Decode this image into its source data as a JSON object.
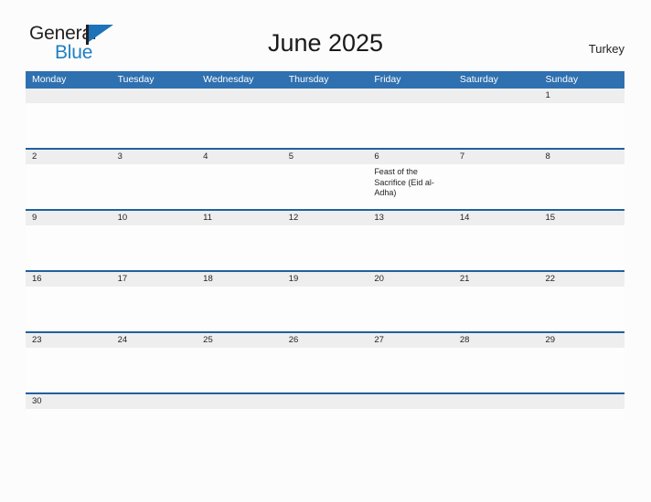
{
  "brand": {
    "name_part1": "General",
    "name_part2": "Blue",
    "flag_icon": "blue-triangle-flag-icon"
  },
  "header": {
    "title": "June 2025",
    "country": "Turkey"
  },
  "colors": {
    "header_blue": "#2f70b0",
    "rule_blue": "#20619e",
    "strip_gray": "#eeeeee",
    "brand_blue": "#1e7fc2",
    "page_background": "#fcfcfc"
  },
  "calendar": {
    "weekdays": [
      "Monday",
      "Tuesday",
      "Wednesday",
      "Thursday",
      "Friday",
      "Saturday",
      "Sunday"
    ],
    "weeks": [
      {
        "days": [
          {
            "number": "",
            "events": []
          },
          {
            "number": "",
            "events": []
          },
          {
            "number": "",
            "events": []
          },
          {
            "number": "",
            "events": []
          },
          {
            "number": "",
            "events": []
          },
          {
            "number": "",
            "events": []
          },
          {
            "number": "1",
            "events": []
          }
        ]
      },
      {
        "days": [
          {
            "number": "2",
            "events": []
          },
          {
            "number": "3",
            "events": []
          },
          {
            "number": "4",
            "events": []
          },
          {
            "number": "5",
            "events": []
          },
          {
            "number": "6",
            "events": [
              "Feast of the Sacrifice (Eid al-Adha)"
            ]
          },
          {
            "number": "7",
            "events": []
          },
          {
            "number": "8",
            "events": []
          }
        ]
      },
      {
        "days": [
          {
            "number": "9",
            "events": []
          },
          {
            "number": "10",
            "events": []
          },
          {
            "number": "11",
            "events": []
          },
          {
            "number": "12",
            "events": []
          },
          {
            "number": "13",
            "events": []
          },
          {
            "number": "14",
            "events": []
          },
          {
            "number": "15",
            "events": []
          }
        ]
      },
      {
        "days": [
          {
            "number": "16",
            "events": []
          },
          {
            "number": "17",
            "events": []
          },
          {
            "number": "18",
            "events": []
          },
          {
            "number": "19",
            "events": []
          },
          {
            "number": "20",
            "events": []
          },
          {
            "number": "21",
            "events": []
          },
          {
            "number": "22",
            "events": []
          }
        ]
      },
      {
        "days": [
          {
            "number": "23",
            "events": []
          },
          {
            "number": "24",
            "events": []
          },
          {
            "number": "25",
            "events": []
          },
          {
            "number": "26",
            "events": []
          },
          {
            "number": "27",
            "events": []
          },
          {
            "number": "28",
            "events": []
          },
          {
            "number": "29",
            "events": []
          }
        ]
      },
      {
        "short": true,
        "days": [
          {
            "number": "30",
            "events": []
          },
          {
            "number": "",
            "events": []
          },
          {
            "number": "",
            "events": []
          },
          {
            "number": "",
            "events": []
          },
          {
            "number": "",
            "events": []
          },
          {
            "number": "",
            "events": []
          },
          {
            "number": "",
            "events": []
          }
        ]
      }
    ]
  }
}
